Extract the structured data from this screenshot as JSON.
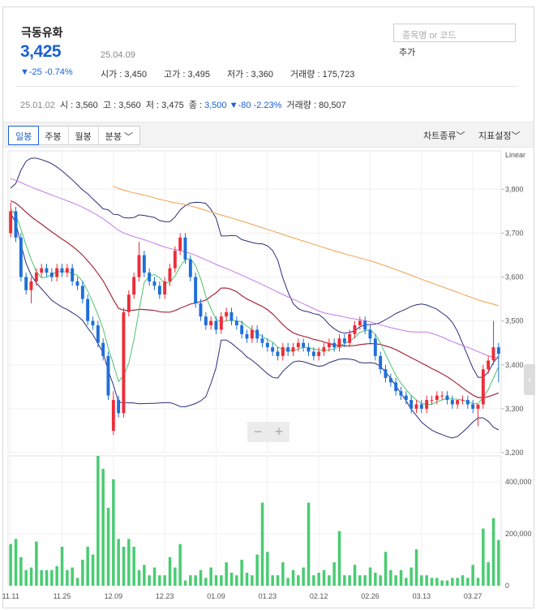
{
  "stock": {
    "name": "극동유화",
    "price": "3,425",
    "change": "▼-25 -0.74%",
    "date": "25.04.09",
    "open_label": "시가",
    "open": "3,450",
    "high_label": "고가",
    "high": "3,495",
    "low_label": "저가",
    "low": "3,360",
    "volume_label": "거래량",
    "volume": "175,723"
  },
  "search": {
    "placeholder": "종목명 or 코드",
    "add_label": "추가"
  },
  "hover_info": {
    "date": "25.01.02",
    "open_label": "시",
    "open": "3,560",
    "high_label": "고",
    "high": "3,560",
    "low_label": "저",
    "low": "3,475",
    "close_label": "종",
    "close": "3,500",
    "change": "▼-80 -2.23%",
    "volume_label": "거래량",
    "volume": "80,507"
  },
  "toolbar": {
    "tabs": [
      {
        "label": "일봉",
        "active": true
      },
      {
        "label": "주봉",
        "active": false
      },
      {
        "label": "월봉",
        "active": false
      },
      {
        "label": "분봉",
        "active": false
      }
    ],
    "chart_type_label": "차트종류",
    "indicator_label": "지표설정"
  },
  "colors": {
    "up": "#ec2d3a",
    "down": "#1e6fd9",
    "ma5": "#4fc36e",
    "ma20": "#a52a3c",
    "ma60": "#c37ce6",
    "ma120": "#f0a050",
    "bollinger": "#2d2d7a",
    "volume": "#49cc72"
  },
  "chart_data": {
    "type": "candlestick",
    "scale_label": "Linear",
    "price_ylim": [
      3200,
      3880
    ],
    "price_ticks": [
      "3,800",
      "3,700",
      "3,600",
      "3,500",
      "3,400",
      "3,300",
      "3,200"
    ],
    "price_tick_values": [
      3800,
      3700,
      3600,
      3500,
      3400,
      3300,
      3200
    ],
    "volume_ylim": [
      0,
      500000
    ],
    "volume_ticks": [
      "400,000",
      "200,000",
      "0"
    ],
    "volume_tick_values": [
      400000,
      200000,
      0
    ],
    "x_tick_labels": [
      "11.11",
      "11.25",
      "12.09",
      "12.23",
      "01.09",
      "01.23",
      "02.12",
      "02.26",
      "03.13",
      "03.27"
    ],
    "x_tick_index": [
      0,
      10,
      20,
      30,
      40,
      50,
      60,
      70,
      80,
      90
    ],
    "close": [
      3750,
      3690,
      3600,
      3570,
      3590,
      3610,
      3620,
      3610,
      3600,
      3620,
      3610,
      3620,
      3590,
      3580,
      3550,
      3500,
      3490,
      3450,
      3420,
      3330,
      3320,
      3290,
      3520,
      3560,
      3600,
      3650,
      3610,
      3590,
      3580,
      3560,
      3590,
      3620,
      3660,
      3690,
      3640,
      3600,
      3540,
      3510,
      3490,
      3500,
      3480,
      3510,
      3520,
      3500,
      3490,
      3470,
      3460,
      3480,
      3460,
      3450,
      3440,
      3430,
      3420,
      3440,
      3430,
      3440,
      3450,
      3440,
      3430,
      3420,
      3430,
      3440,
      3450,
      3440,
      3460,
      3450,
      3470,
      3490,
      3500,
      3480,
      3460,
      3420,
      3390,
      3370,
      3360,
      3340,
      3330,
      3320,
      3300,
      3310,
      3300,
      3320,
      3320,
      3330,
      3330,
      3320,
      3310,
      3320,
      3320,
      3310,
      3300,
      3310,
      3390,
      3410,
      3440,
      3425
    ],
    "open": [
      3700,
      3750,
      3690,
      3600,
      3570,
      3590,
      3610,
      3620,
      3610,
      3600,
      3620,
      3610,
      3620,
      3590,
      3580,
      3550,
      3500,
      3490,
      3450,
      3420,
      3250,
      3320,
      3290,
      3520,
      3560,
      3600,
      3650,
      3610,
      3590,
      3580,
      3560,
      3590,
      3620,
      3660,
      3690,
      3640,
      3600,
      3540,
      3510,
      3490,
      3500,
      3480,
      3510,
      3520,
      3500,
      3490,
      3470,
      3460,
      3480,
      3460,
      3450,
      3440,
      3430,
      3420,
      3440,
      3430,
      3440,
      3450,
      3440,
      3430,
      3420,
      3430,
      3440,
      3450,
      3440,
      3460,
      3450,
      3470,
      3490,
      3500,
      3480,
      3460,
      3420,
      3390,
      3370,
      3360,
      3340,
      3330,
      3320,
      3300,
      3310,
      3300,
      3320,
      3320,
      3330,
      3330,
      3320,
      3310,
      3320,
      3320,
      3310,
      3300,
      3310,
      3390,
      3410,
      3440
    ],
    "high": [
      3770,
      3760,
      3700,
      3610,
      3600,
      3620,
      3630,
      3630,
      3620,
      3630,
      3630,
      3630,
      3630,
      3600,
      3590,
      3560,
      3510,
      3500,
      3460,
      3430,
      3340,
      3330,
      3530,
      3570,
      3610,
      3680,
      3660,
      3620,
      3600,
      3590,
      3600,
      3630,
      3670,
      3700,
      3700,
      3650,
      3610,
      3550,
      3520,
      3510,
      3510,
      3520,
      3530,
      3530,
      3510,
      3500,
      3480,
      3490,
      3490,
      3470,
      3460,
      3450,
      3440,
      3450,
      3450,
      3450,
      3460,
      3460,
      3450,
      3440,
      3440,
      3450,
      3460,
      3460,
      3470,
      3470,
      3480,
      3500,
      3510,
      3510,
      3490,
      3470,
      3430,
      3400,
      3380,
      3370,
      3350,
      3340,
      3330,
      3320,
      3320,
      3330,
      3330,
      3340,
      3340,
      3340,
      3330,
      3320,
      3330,
      3330,
      3320,
      3310,
      3400,
      3420,
      3500,
      3450
    ],
    "low": [
      3690,
      3680,
      3590,
      3560,
      3540,
      3580,
      3600,
      3600,
      3590,
      3590,
      3600,
      3600,
      3580,
      3570,
      3540,
      3490,
      3480,
      3440,
      3410,
      3320,
      3240,
      3280,
      3280,
      3510,
      3550,
      3590,
      3600,
      3580,
      3570,
      3550,
      3550,
      3580,
      3610,
      3650,
      3630,
      3590,
      3530,
      3500,
      3480,
      3480,
      3470,
      3470,
      3500,
      3490,
      3480,
      3460,
      3450,
      3450,
      3450,
      3440,
      3430,
      3420,
      3410,
      3410,
      3420,
      3420,
      3430,
      3430,
      3420,
      3410,
      3410,
      3420,
      3430,
      3430,
      3430,
      3440,
      3440,
      3460,
      3480,
      3470,
      3450,
      3410,
      3380,
      3360,
      3350,
      3330,
      3320,
      3310,
      3290,
      3290,
      3290,
      3290,
      3310,
      3310,
      3320,
      3310,
      3300,
      3300,
      3310,
      3300,
      3290,
      3260,
      3300,
      3380,
      3400,
      3360
    ],
    "volume": [
      160000,
      180000,
      110000,
      60000,
      70000,
      170000,
      60000,
      60000,
      60000,
      75000,
      150000,
      60000,
      70000,
      30000,
      100000,
      150000,
      120000,
      500000,
      450000,
      300000,
      410000,
      180000,
      150000,
      180000,
      150000,
      60000,
      80000,
      40000,
      70000,
      40000,
      40000,
      110000,
      70000,
      160000,
      20000,
      40000,
      40000,
      60000,
      30000,
      70000,
      40000,
      40000,
      90000,
      50000,
      40000,
      100000,
      50000,
      40000,
      120000,
      320000,
      130000,
      40000,
      40000,
      90000,
      30000,
      60000,
      40000,
      70000,
      320000,
      40000,
      50000,
      60000,
      40000,
      90000,
      210000,
      40000,
      40000,
      80000,
      40000,
      40000,
      70000,
      50000,
      40000,
      130000,
      60000,
      40000,
      60000,
      30000,
      70000,
      140000,
      40000,
      40000,
      30000,
      30000,
      20000,
      20000,
      30000,
      30000,
      40000,
      30000,
      80000,
      30000,
      220000,
      90000,
      260000,
      175723
    ]
  }
}
